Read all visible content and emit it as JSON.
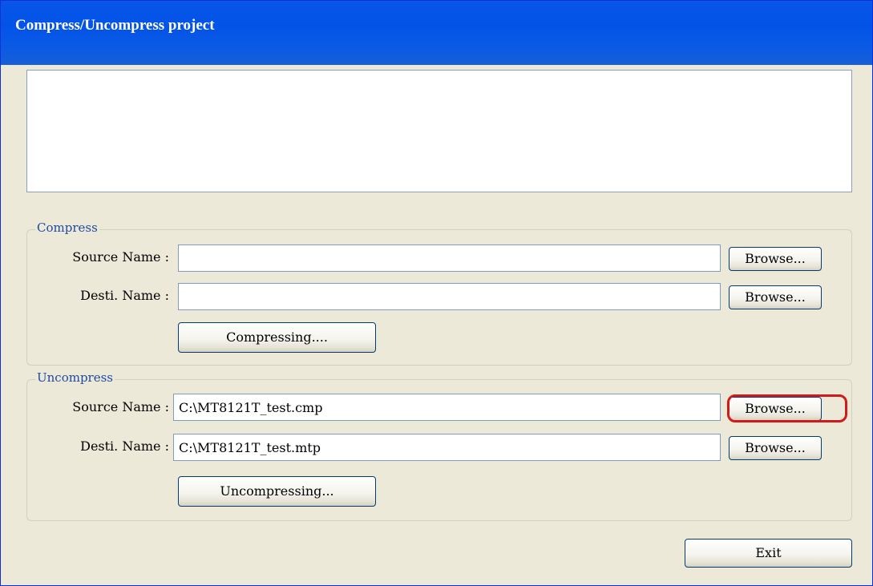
{
  "window": {
    "title": "Compress/Uncompress project"
  },
  "compress": {
    "legend": "Compress",
    "source_label": "Source Name :",
    "source_value": "",
    "dest_label": "Desti. Name :",
    "dest_value": "",
    "browse_label": "Browse...",
    "action_label": "Compressing...."
  },
  "uncompress": {
    "legend": "Uncompress",
    "source_label": "Source Name :",
    "source_value": "C:\\MT8121T_test.cmp",
    "dest_label": "Desti. Name :",
    "dest_value": "C:\\MT8121T_test.mtp",
    "browse_label": "Browse...",
    "action_label": "Uncompressing..."
  },
  "footer": {
    "exit_label": "Exit"
  },
  "colors": {
    "title_bar": "#0453e8",
    "window_bg": "#ece9d8",
    "legend_text": "#1f4aa3",
    "highlight": "#d21a1a"
  }
}
